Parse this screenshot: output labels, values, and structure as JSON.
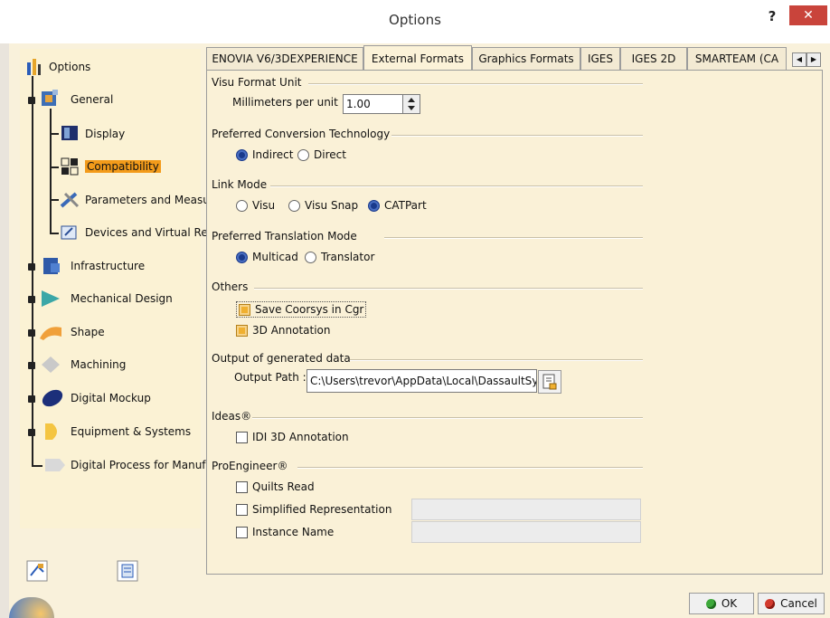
{
  "window": {
    "title": "Options",
    "help_label": "?",
    "close_label": "✕"
  },
  "tree": {
    "root": "Options",
    "items": [
      {
        "label": "General"
      },
      {
        "label": "Display"
      },
      {
        "label": "Compatibility"
      },
      {
        "label": "Parameters and Measu"
      },
      {
        "label": "Devices and Virtual Rea"
      },
      {
        "label": "Infrastructure"
      },
      {
        "label": "Mechanical Design"
      },
      {
        "label": "Shape"
      },
      {
        "label": "Machining"
      },
      {
        "label": "Digital Mockup"
      },
      {
        "label": "Equipment & Systems"
      },
      {
        "label": "Digital Process for Manufa"
      }
    ]
  },
  "tabs": [
    {
      "label": "ENOVIA V6/3DEXPERIENCE"
    },
    {
      "label": "External Formats"
    },
    {
      "label": "Graphics Formats"
    },
    {
      "label": "IGES"
    },
    {
      "label": "IGES 2D"
    },
    {
      "label": "SMARTEAM (CA"
    }
  ],
  "tab_scroll": {
    "left": "◀",
    "right": "▶"
  },
  "visu_format": {
    "title": "Visu Format Unit",
    "mm_label": "Millimeters per unit :",
    "mm_value": "1.00"
  },
  "conversion": {
    "title": "Preferred Conversion Technology",
    "options": [
      "Indirect",
      "Direct"
    ],
    "selected": "Indirect"
  },
  "link_mode": {
    "title": "Link Mode",
    "options": [
      "Visu",
      "Visu Snap",
      "CATPart"
    ],
    "selected": "CATPart"
  },
  "translation": {
    "title": "Preferred Translation Mode",
    "options": [
      "Multicad",
      "Translator"
    ],
    "selected": "Multicad"
  },
  "others": {
    "title": "Others",
    "save_coorsys": "Save Coorsys in Cgr",
    "annotation": "3D Annotation"
  },
  "output": {
    "title": "Output of generated data",
    "path_label": "Output Path :",
    "path_value": "C:\\Users\\trevor\\AppData\\Local\\DassaultSys"
  },
  "ideas": {
    "title": "Ideas®",
    "idi_annotation": "IDI 3D Annotation"
  },
  "proengineer": {
    "title": "ProEngineer®",
    "quilts": "Quilts Read",
    "simplified": "Simplified Representation",
    "instance": "Instance Name"
  },
  "buttons": {
    "ok": "OK",
    "cancel": "Cancel"
  },
  "colors": {
    "panel_bg": "#faf1d7",
    "tree_bg": "#fbf2d4",
    "selection": "#f39b1a",
    "close_red": "#c9443b"
  }
}
